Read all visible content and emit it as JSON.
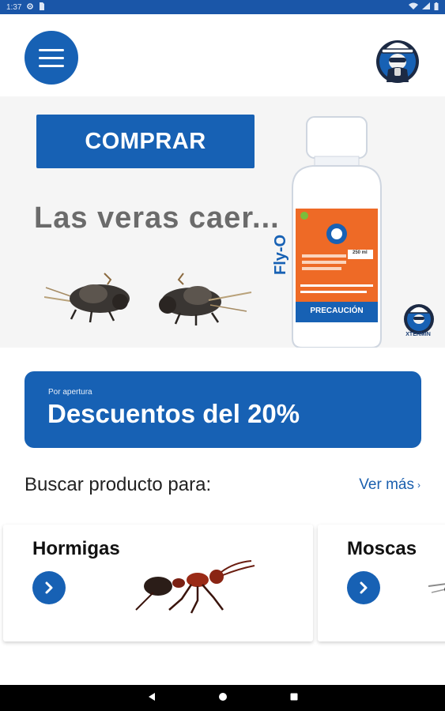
{
  "status_bar": {
    "time": "1:37",
    "background_color": "#1a56a8"
  },
  "header": {
    "menu_icon": "hamburger-menu-icon",
    "logo_icon": "exterminator-mascot-logo-icon"
  },
  "banner": {
    "buy_label": "COMPRAR",
    "headline": "Las veras caer...",
    "product": {
      "bottle_brand": "Fly-O",
      "bottle_warning": "PRECAUCIÓN",
      "bottle_volume": "250 ml"
    },
    "brand_tag": "XTERMIN",
    "accent_color": "#1761b4"
  },
  "promo": {
    "small_text": "Por apertura",
    "title": "Descuentos del 20%"
  },
  "search": {
    "label": "Buscar producto para:",
    "more_label": "Ver más"
  },
  "categories": [
    {
      "name": "Hormigas",
      "icon": "ant-icon"
    },
    {
      "name": "Moscas",
      "icon": "fly-icon"
    }
  ],
  "nav_bar": {
    "back_icon": "back-triangle-icon",
    "home_icon": "home-circle-icon",
    "recents_icon": "recents-square-icon"
  }
}
